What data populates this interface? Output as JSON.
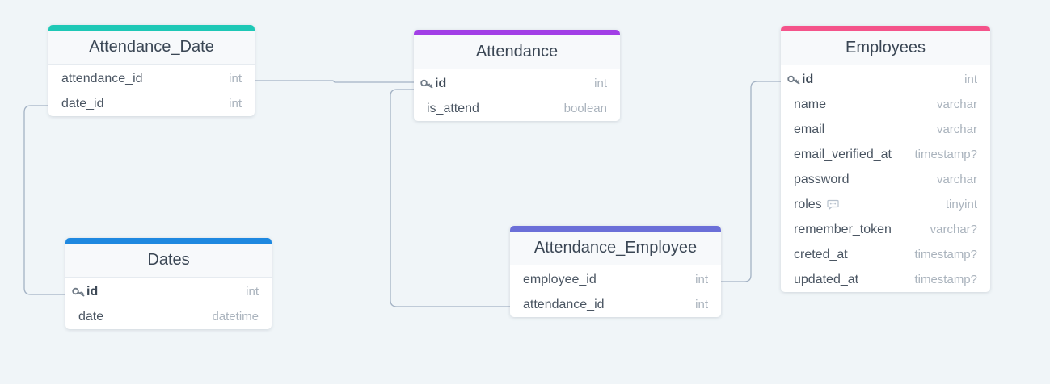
{
  "tables": {
    "attendance_date": {
      "title": "Attendance_Date",
      "color": "#1ec8b6",
      "fields": [
        {
          "name": "attendance_id",
          "type": "int"
        },
        {
          "name": "date_id",
          "type": "int"
        }
      ]
    },
    "attendance": {
      "title": "Attendance",
      "color": "#a23fe6",
      "fields": [
        {
          "name": "id",
          "type": "int"
        },
        {
          "name": "is_attend",
          "type": "boolean"
        }
      ]
    },
    "employees": {
      "title": "Employees",
      "color": "#f4538a",
      "fields": [
        {
          "name": "id",
          "type": "int"
        },
        {
          "name": "name",
          "type": "varchar"
        },
        {
          "name": "email",
          "type": "varchar"
        },
        {
          "name": "email_verified_at",
          "type": "timestamp?"
        },
        {
          "name": "password",
          "type": "varchar"
        },
        {
          "name": "roles",
          "type": "tinyint"
        },
        {
          "name": "remember_token",
          "type": "varchar?"
        },
        {
          "name": "creted_at",
          "type": "timestamp?"
        },
        {
          "name": "updated_at",
          "type": "timestamp?"
        }
      ]
    },
    "dates": {
      "title": "Dates",
      "color": "#1e88e0",
      "fields": [
        {
          "name": "id",
          "type": "int"
        },
        {
          "name": "date",
          "type": "datetime"
        }
      ]
    },
    "attendance_employee": {
      "title": "Attendance_Employee",
      "color": "#6b6fd8",
      "fields": [
        {
          "name": "employee_id",
          "type": "int"
        },
        {
          "name": "attendance_id",
          "type": "int"
        }
      ]
    }
  },
  "icons": {
    "primary_key": "key-icon",
    "comment": "comment-icon"
  },
  "colors": {
    "canvas": "#f0f5f8",
    "connector": "#a3b2c4"
  }
}
